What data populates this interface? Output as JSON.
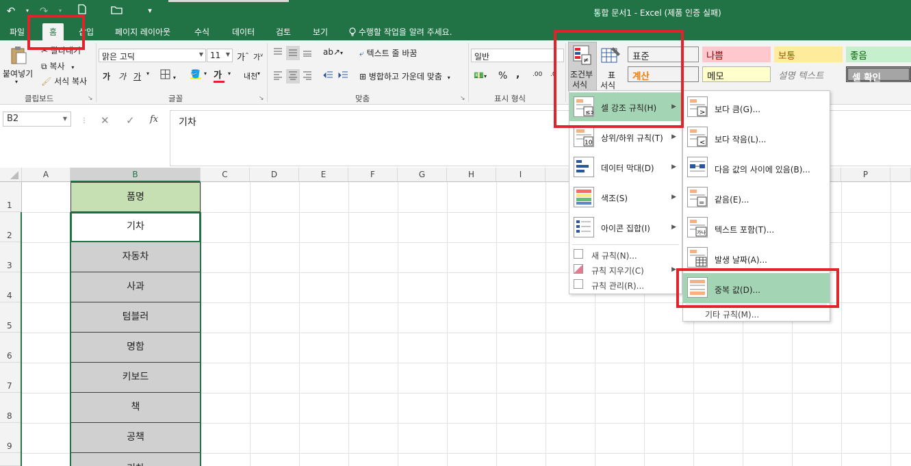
{
  "title_bar": {
    "title": "통합 문서1 - Excel (제품 인증 실패)",
    "qat": {
      "undo": "↶",
      "redo": "↷",
      "new": "🗋",
      "open": "📂",
      "customize": "▾"
    }
  },
  "tabs": [
    "파일",
    "홈",
    "삽입",
    "페이지 레이아웃",
    "수식",
    "데이터",
    "검토",
    "보기"
  ],
  "active_tab": "홈",
  "tell_me": "수행할 작업을 알려 주세요.",
  "ribbon": {
    "clipboard": {
      "paste": "붙여넣기",
      "cut": "잘라내기",
      "copy": "복사",
      "format_painter": "서식 복사",
      "label": "클립보드"
    },
    "font": {
      "name": "맑은 고딕",
      "size": "11",
      "grow": "가",
      "shrink": "가",
      "bold": "가",
      "italic": "가",
      "underline": "가",
      "font_color": "가",
      "phonetic": "내천",
      "label": "글꼴"
    },
    "alignment": {
      "wrap": "텍스트 줄 바꿈",
      "merge": "병합하고 가운데 맞춤",
      "label": "맞춤"
    },
    "number": {
      "format": "일반",
      "percent": "%",
      "comma": ",",
      "label": "표시 형식"
    },
    "styles": {
      "conditional_formatting": "조건부\n서식",
      "cf_line1": "조건부",
      "cf_line2": "서식",
      "table_line1": "표",
      "table_line2": "서식",
      "cells": [
        {
          "label": "표준",
          "bg": "#ffffff",
          "color": "#000000"
        },
        {
          "label": "나쁨",
          "bg": "#ffc7ce",
          "color": "#9c0006"
        },
        {
          "label": "보통",
          "bg": "#ffeb9c",
          "color": "#9c5700"
        },
        {
          "label": "좋음",
          "bg": "#c6efce",
          "color": "#006100"
        },
        {
          "label": "계산",
          "bg": "#f2f2f2",
          "color": "#fa7d00"
        },
        {
          "label": "메모",
          "bg": "#ffffcc",
          "color": "#000000"
        },
        {
          "label": "설명 텍스트",
          "bg": "#f3f3f3",
          "color": "#7f7f7f"
        },
        {
          "label": "셀 확인",
          "bg": "#a5a5a5",
          "color": "#ffffff"
        }
      ]
    }
  },
  "formula_bar": {
    "name_box": "B2",
    "cancel": "✕",
    "enter": "✓",
    "fx": "fx",
    "value": "기차"
  },
  "grid": {
    "columns": [
      "A",
      "B",
      "C",
      "D",
      "E",
      "F",
      "G",
      "H",
      "I",
      "J",
      "K",
      "L",
      "M",
      "N",
      "O",
      "P"
    ],
    "visible_column_labels": [
      "A",
      "B",
      "C",
      "D",
      "E",
      "F",
      "G",
      "H",
      "I",
      "P"
    ],
    "rows": [
      "1",
      "2",
      "3",
      "4",
      "5",
      "6",
      "7",
      "8",
      "9"
    ],
    "b_values": [
      "품명",
      "기차",
      "자동차",
      "사과",
      "텀블러",
      "명함",
      "키보드",
      "책",
      "공책",
      "기차"
    ]
  },
  "cf_menu": {
    "items": [
      {
        "label": "셀 강조 규칙(H)",
        "submenu": true,
        "icon": "highlight-rules-icon"
      },
      {
        "label": "상위/하위 규칙(T)",
        "submenu": true,
        "icon": "top-bottom-rules-icon"
      },
      {
        "label": "데이터 막대(D)",
        "submenu": true,
        "icon": "data-bars-icon"
      },
      {
        "label": "색조(S)",
        "submenu": true,
        "icon": "color-scales-icon"
      },
      {
        "label": "아이콘 집합(I)",
        "submenu": true,
        "icon": "icon-sets-icon"
      }
    ],
    "small_items": [
      "새 규칙(N)...",
      "규칙 지우기(C)",
      "규칙 관리(R)..."
    ]
  },
  "highlight_menu": {
    "items": [
      "보다 큼(G)...",
      "보다 작음(L)...",
      "다음 값의 사이에 있음(B)...",
      "같음(E)...",
      "텍스트 포함(T)...",
      "발생 날짜(A)...",
      "중복 값(D)..."
    ],
    "more": "기타 규칙(M)..."
  },
  "colors": {
    "accent": "#217346",
    "highlight": "#a3d5b4",
    "annotation": "#e0242b"
  }
}
